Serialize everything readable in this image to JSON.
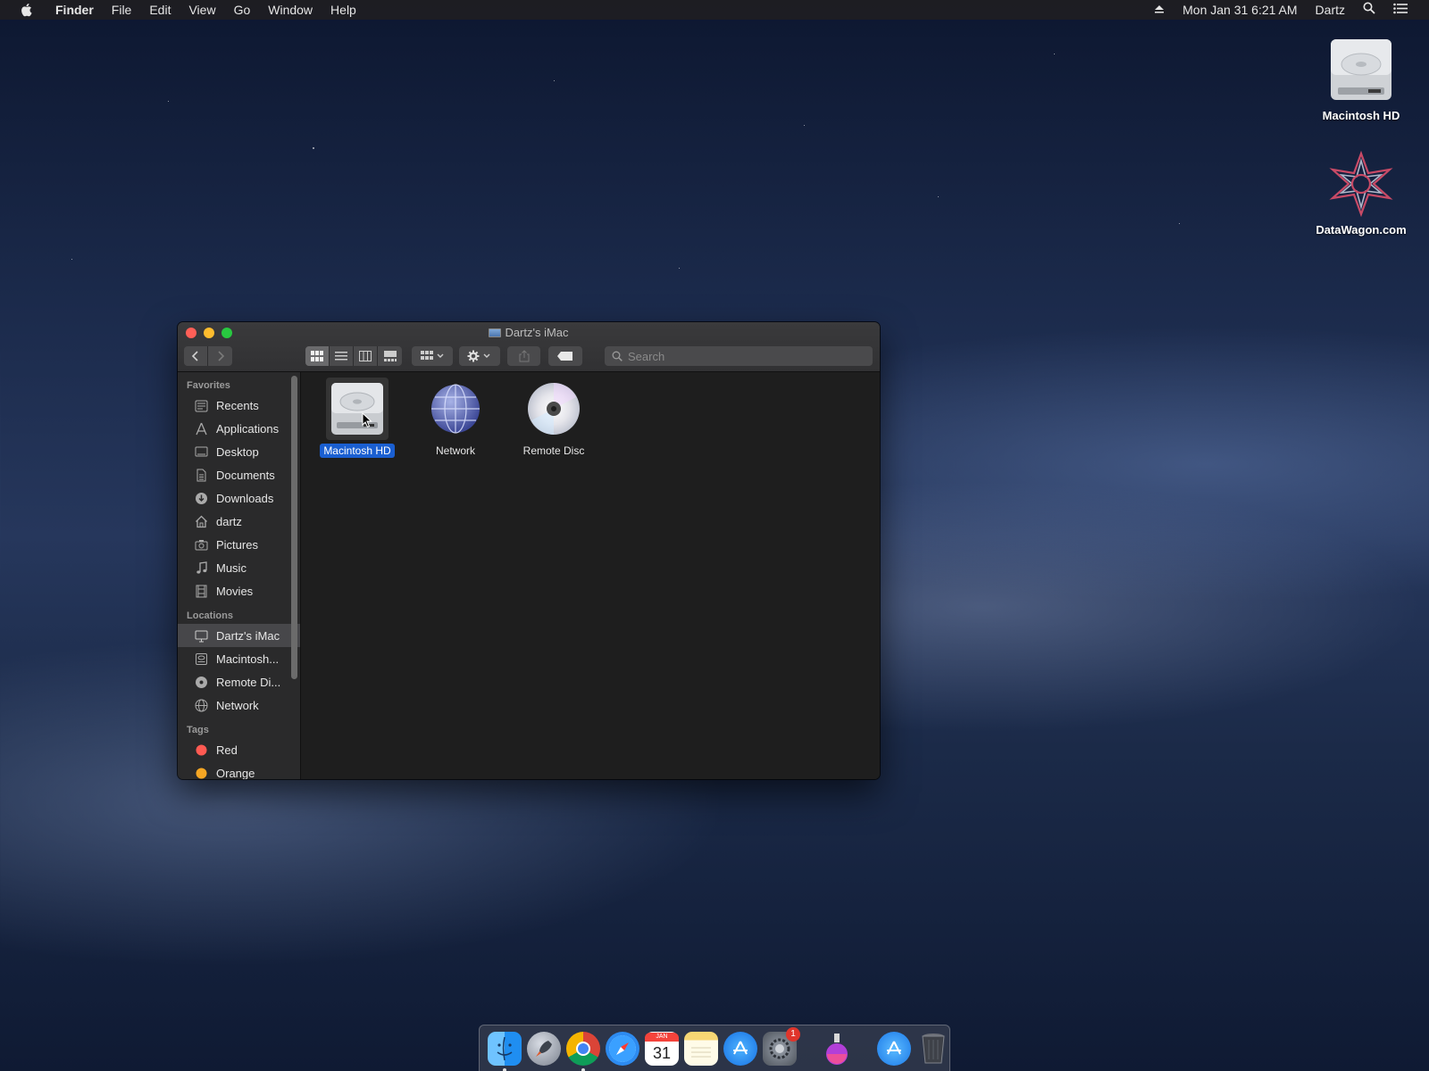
{
  "menubar": {
    "app_name": "Finder",
    "menus": [
      "File",
      "Edit",
      "View",
      "Go",
      "Window",
      "Help"
    ],
    "clock": "Mon Jan 31  6:21 AM",
    "user": "Dartz"
  },
  "desktop": {
    "icons": [
      {
        "label": "Macintosh HD",
        "icon": "hard-drive-icon"
      },
      {
        "label": "DataWagon.com",
        "icon": "datawagon-logo-icon"
      }
    ]
  },
  "finder": {
    "title": "Dartz's iMac",
    "search": {
      "placeholder": "Search",
      "value": ""
    },
    "view_modes": [
      "icon",
      "list",
      "column",
      "gallery"
    ],
    "active_view": "icon",
    "sidebar": {
      "favorites_header": "Favorites",
      "favorites": [
        {
          "label": "Recents",
          "icon": "clock-icon"
        },
        {
          "label": "Applications",
          "icon": "applications-icon"
        },
        {
          "label": "Desktop",
          "icon": "desktop-icon"
        },
        {
          "label": "Documents",
          "icon": "document-icon"
        },
        {
          "label": "Downloads",
          "icon": "download-icon"
        },
        {
          "label": "dartz",
          "icon": "home-icon"
        },
        {
          "label": "Pictures",
          "icon": "camera-icon"
        },
        {
          "label": "Music",
          "icon": "music-note-icon"
        },
        {
          "label": "Movies",
          "icon": "film-icon"
        }
      ],
      "locations_header": "Locations",
      "locations": [
        {
          "label": "Dartz's iMac",
          "icon": "computer-icon",
          "selected": true
        },
        {
          "label": "Macintosh...",
          "icon": "hard-drive-icon"
        },
        {
          "label": "Remote Di...",
          "icon": "disc-icon"
        },
        {
          "label": "Network",
          "icon": "globe-icon"
        }
      ],
      "tags_header": "Tags",
      "tags": [
        {
          "label": "Red",
          "color": "#ff5a52"
        },
        {
          "label": "Orange",
          "color": "#f5a623"
        }
      ]
    },
    "files": [
      {
        "label": "Macintosh HD",
        "icon": "hard-drive-icon",
        "selected": true
      },
      {
        "label": "Network",
        "icon": "globe-icon",
        "selected": false
      },
      {
        "label": "Remote Disc",
        "icon": "disc-icon",
        "selected": false
      }
    ]
  },
  "dock": {
    "apps": [
      {
        "name": "Finder",
        "icon": "finder-icon",
        "running": true
      },
      {
        "name": "Launchpad",
        "icon": "rocket-icon",
        "running": false
      },
      {
        "name": "Chrome",
        "icon": "chrome-icon",
        "running": true
      },
      {
        "name": "Safari",
        "icon": "compass-icon",
        "running": false
      },
      {
        "name": "Calendar",
        "icon": "calendar-icon",
        "month": "JAN",
        "day": "31",
        "running": false
      },
      {
        "name": "Notes",
        "icon": "notes-icon",
        "running": false
      },
      {
        "name": "App Store",
        "icon": "app-store-icon",
        "running": false
      },
      {
        "name": "System Preferences",
        "icon": "gear-icon",
        "badge": "1",
        "running": false
      },
      {
        "name": "Installer",
        "icon": "flask-icon",
        "running": false
      },
      {
        "name": "App Store Downloads",
        "icon": "app-store-folder-icon",
        "running": false
      },
      {
        "name": "Trash",
        "icon": "trash-icon",
        "running": false
      }
    ]
  },
  "colors": {
    "selection": "#1a5fd1",
    "close": "#ff5f57",
    "minimize": "#febc2e",
    "zoom": "#28c840"
  }
}
